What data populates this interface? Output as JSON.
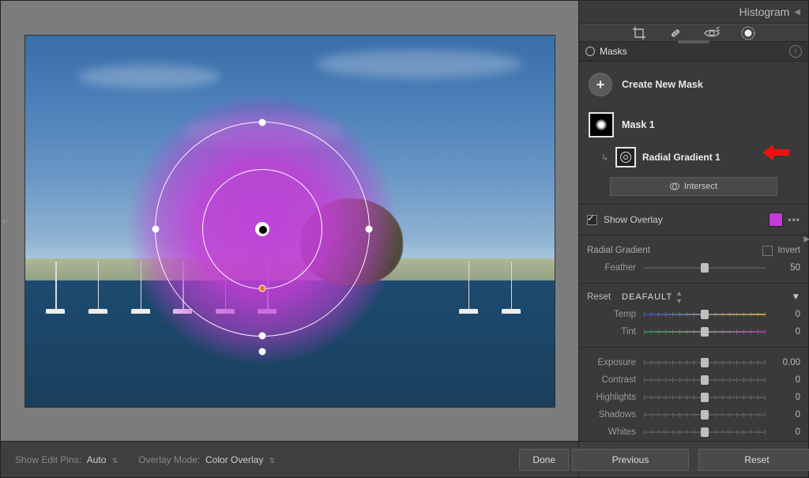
{
  "histogram_header": "Histogram",
  "masks_panel": {
    "title": "Masks",
    "create_label": "Create New Mask",
    "mask1_label": "Mask 1",
    "subitem_label": "Radial Gradient 1",
    "intersect_label": "Intersect"
  },
  "overlay": {
    "show_label": "Show Overlay",
    "checked": true,
    "color": "#c23dd6"
  },
  "radial": {
    "title": "Radial Gradient",
    "invert_label": "Invert",
    "feather_label": "Feather",
    "feather_value": "50"
  },
  "sliders": {
    "reset_label": "Reset",
    "preset_label": "DEAFAULT",
    "rows": [
      {
        "label": "Temp",
        "value": "0",
        "pos": 50,
        "cls": "temp"
      },
      {
        "label": "Tint",
        "value": "0",
        "pos": 50,
        "cls": "tint"
      }
    ],
    "rows2": [
      {
        "label": "Exposure",
        "value": "0.00",
        "pos": 50
      },
      {
        "label": "Contrast",
        "value": "0",
        "pos": 50
      },
      {
        "label": "Highlights",
        "value": "0",
        "pos": 50
      },
      {
        "label": "Shadows",
        "value": "0",
        "pos": 50
      },
      {
        "label": "Whites",
        "value": "0",
        "pos": 50
      }
    ]
  },
  "footer": {
    "show_pins_label": "Show Edit Pins:",
    "show_pins_value": "Auto",
    "overlay_mode_label": "Overlay Mode:",
    "overlay_mode_value": "Color Overlay",
    "done": "Done",
    "previous": "Previous",
    "reset": "Reset"
  }
}
